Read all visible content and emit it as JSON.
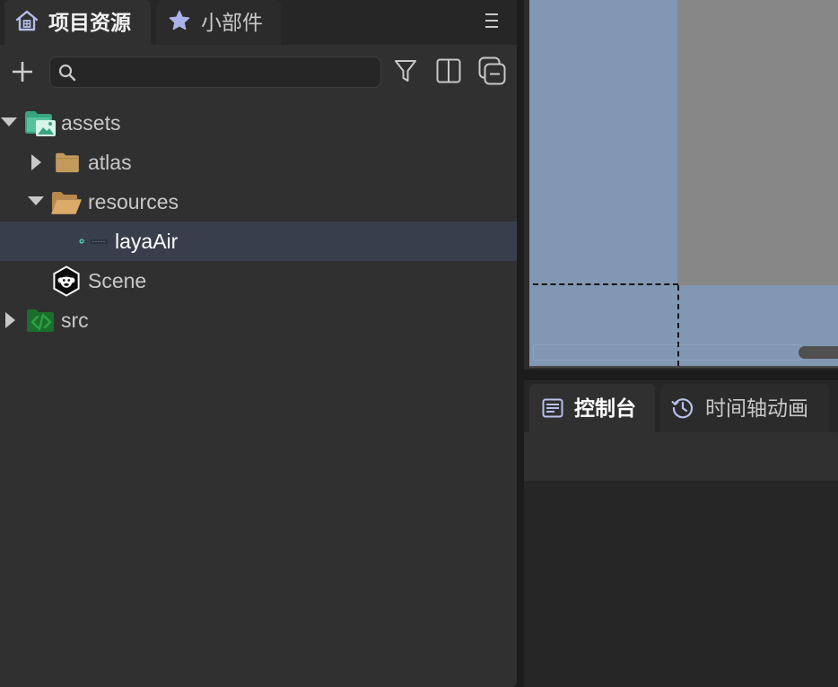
{
  "left_panel": {
    "tabs": [
      {
        "label": "项目资源",
        "icon": "home-icon",
        "active": true
      },
      {
        "label": "小部件",
        "icon": "star-icon",
        "active": false
      }
    ],
    "menu_icon": "menu-icon",
    "toolbar": {
      "add_icon": "plus-icon",
      "search": {
        "value": "",
        "placeholder": "",
        "icon": "search-icon"
      },
      "filter_icon": "filter-icon",
      "layout_icon": "split-columns-icon",
      "collapse_icon": "collapse-all-icon"
    },
    "tree": [
      {
        "label": "assets",
        "icon": "assets-folder-icon",
        "expanded": true,
        "children": [
          {
            "label": "atlas",
            "icon": "folder-icon",
            "expanded": false
          },
          {
            "label": "resources",
            "icon": "open-folder-icon",
            "expanded": true,
            "children": [
              {
                "label": "layaAir",
                "icon": "image-thumbnail-icon",
                "selected": true
              }
            ]
          },
          {
            "label": "Scene",
            "icon": "scene-icon"
          }
        ]
      },
      {
        "label": "src",
        "icon": "script-folder-icon",
        "expanded": false
      }
    ]
  },
  "scene_view": {
    "background_color": "#8197b4",
    "canvas_color": "#878787"
  },
  "bottom_panel": {
    "tabs": [
      {
        "label": "控制台",
        "icon": "console-icon",
        "active": true
      },
      {
        "label": "时间轴动画",
        "icon": "clock-icon",
        "active": false
      }
    ]
  },
  "colors": {
    "panel": "#303030",
    "selection": "#393e4c",
    "text": "#c8c8c8",
    "icon_accent": "#b4bde8"
  }
}
